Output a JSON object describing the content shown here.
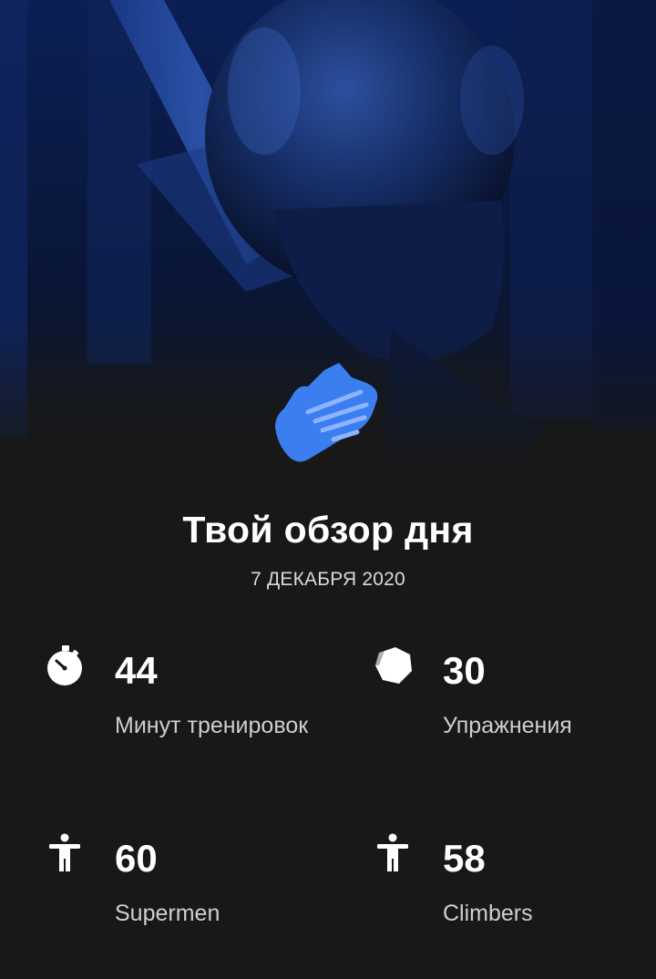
{
  "summary": {
    "title": "Твой обзор дня",
    "date": "7 ДЕКАБРЯ 2020"
  },
  "stats": [
    {
      "icon": "stopwatch-icon",
      "value": "44",
      "label": "Минут тренировок"
    },
    {
      "icon": "hexagon-icon",
      "value": "30",
      "label": "Упражнения"
    },
    {
      "icon": "person-icon",
      "value": "60",
      "label": "Supermen"
    },
    {
      "icon": "person-icon",
      "value": "58",
      "label": "Climbers"
    }
  ],
  "colors": {
    "background": "#181818",
    "accent": "#3b7ef0",
    "hero_tint": "#0d2a6b"
  }
}
